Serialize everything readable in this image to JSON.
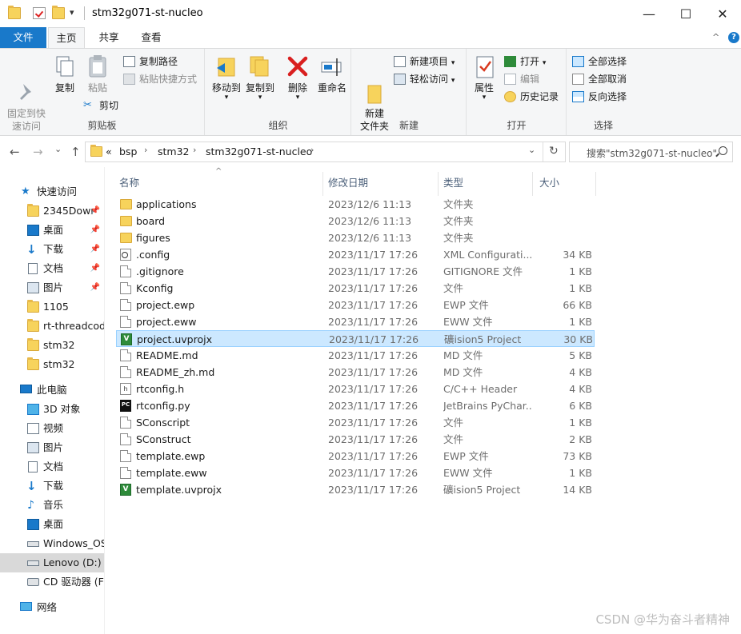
{
  "window": {
    "title": "stm32g071-st-nucleo",
    "minimize": "—",
    "maximize": "☐",
    "close": "✕",
    "quick_menu_arrow": "▾"
  },
  "ribbon_tabs": {
    "file": "文件",
    "home": "主页",
    "share": "共享",
    "view": "查看",
    "collapse_arrow": "^",
    "help": "?"
  },
  "ribbon": {
    "clipboard": {
      "label": "剪贴板",
      "pin_quick_access": "固定到快\n速访问",
      "copy": "复制",
      "paste": "粘贴",
      "copy_path": "复制路径",
      "paste_shortcut": "粘贴快捷方式",
      "cut": "剪切"
    },
    "organize": {
      "label": "组织",
      "move_to": "移动到",
      "copy_to": "复制到",
      "delete": "删除",
      "rename": "重命名"
    },
    "new": {
      "label": "新建",
      "new_folder": "新建\n文件夹",
      "new_item": "新建项目",
      "easy_access": "轻松访问"
    },
    "open": {
      "label": "打开",
      "properties": "属性",
      "open": "打开",
      "edit": "编辑",
      "history": "历史记录"
    },
    "select": {
      "label": "选择",
      "select_all": "全部选择",
      "select_none": "全部取消",
      "invert": "反向选择"
    }
  },
  "address": {
    "back": "←",
    "forward": "→",
    "recent": "⌄",
    "up": "↑",
    "overflow": "«",
    "crumbs": [
      "bsp",
      "stm32",
      "stm32g071-st-nucleo"
    ],
    "sep": "›",
    "dropdown": "⌄",
    "refresh": "↻",
    "search_placeholder": "搜索\"stm32g071-st-nucleo\""
  },
  "sidebar": {
    "items": [
      {
        "label": "快速访问",
        "icon": "star-icon"
      },
      {
        "label": "2345Dowr",
        "icon": "folder-icon",
        "pinned": true
      },
      {
        "label": "桌面",
        "icon": "desktop-icon",
        "pinned": true
      },
      {
        "label": "下载",
        "icon": "download-icon",
        "pinned": true
      },
      {
        "label": "文档",
        "icon": "document-icon",
        "pinned": true
      },
      {
        "label": "图片",
        "icon": "picture-icon",
        "pinned": true
      },
      {
        "label": "1105",
        "icon": "folder-icon"
      },
      {
        "label": "rt-threadcod",
        "icon": "folder-icon"
      },
      {
        "label": "stm32",
        "icon": "folder-icon"
      },
      {
        "label": "stm32",
        "icon": "folder-icon"
      },
      {
        "label": "此电脑",
        "icon": "computer-icon"
      },
      {
        "label": "3D 对象",
        "icon": "3d-objects-icon"
      },
      {
        "label": "视频",
        "icon": "video-icon"
      },
      {
        "label": "图片",
        "icon": "picture-icon"
      },
      {
        "label": "文档",
        "icon": "document-icon"
      },
      {
        "label": "下载",
        "icon": "download-icon"
      },
      {
        "label": "音乐",
        "icon": "music-icon"
      },
      {
        "label": "桌面",
        "icon": "desktop-icon"
      },
      {
        "label": "Windows_OS",
        "icon": "drive-icon"
      },
      {
        "label": "Lenovo (D:)",
        "icon": "drive-icon"
      },
      {
        "label": "CD 驱动器 (F:",
        "icon": "cd-drive-icon"
      },
      {
        "label": "网络",
        "icon": "network-icon"
      }
    ],
    "pin_glyph": "📌"
  },
  "columns": {
    "name": "名称",
    "date": "修改日期",
    "type": "类型",
    "size": "大小",
    "sort_arrow": "^"
  },
  "files": [
    {
      "name": "applications",
      "date": "2023/12/6 11:13",
      "type": "文件夹",
      "size": "",
      "icon": "folder"
    },
    {
      "name": "board",
      "date": "2023/12/6 11:13",
      "type": "文件夹",
      "size": "",
      "icon": "folder"
    },
    {
      "name": "figures",
      "date": "2023/12/6 11:13",
      "type": "文件夹",
      "size": "",
      "icon": "folder"
    },
    {
      "name": ".config",
      "date": "2023/11/17 17:26",
      "type": "XML Configurati...",
      "size": "34 KB",
      "icon": "cfg"
    },
    {
      "name": ".gitignore",
      "date": "2023/11/17 17:26",
      "type": "GITIGNORE 文件",
      "size": "1 KB",
      "icon": "doc"
    },
    {
      "name": "Kconfig",
      "date": "2023/11/17 17:26",
      "type": "文件",
      "size": "1 KB",
      "icon": "doc"
    },
    {
      "name": "project.ewp",
      "date": "2023/11/17 17:26",
      "type": "EWP 文件",
      "size": "66 KB",
      "icon": "doc"
    },
    {
      "name": "project.eww",
      "date": "2023/11/17 17:26",
      "type": "EWW 文件",
      "size": "1 KB",
      "icon": "doc"
    },
    {
      "name": "project.uvprojx",
      "date": "2023/11/17 17:26",
      "type": "礦ision5 Project",
      "size": "30 KB",
      "icon": "uv",
      "selected": true
    },
    {
      "name": "README.md",
      "date": "2023/11/17 17:26",
      "type": "MD 文件",
      "size": "5 KB",
      "icon": "doc"
    },
    {
      "name": "README_zh.md",
      "date": "2023/11/17 17:26",
      "type": "MD 文件",
      "size": "4 KB",
      "icon": "doc"
    },
    {
      "name": "rtconfig.h",
      "date": "2023/11/17 17:26",
      "type": "C/C++ Header",
      "size": "4 KB",
      "icon": "h"
    },
    {
      "name": "rtconfig.py",
      "date": "2023/11/17 17:26",
      "type": "JetBrains PyChar...",
      "size": "6 KB",
      "icon": "pc"
    },
    {
      "name": "SConscript",
      "date": "2023/11/17 17:26",
      "type": "文件",
      "size": "1 KB",
      "icon": "doc"
    },
    {
      "name": "SConstruct",
      "date": "2023/11/17 17:26",
      "type": "文件",
      "size": "2 KB",
      "icon": "doc"
    },
    {
      "name": "template.ewp",
      "date": "2023/11/17 17:26",
      "type": "EWP 文件",
      "size": "73 KB",
      "icon": "doc"
    },
    {
      "name": "template.eww",
      "date": "2023/11/17 17:26",
      "type": "EWW 文件",
      "size": "1 KB",
      "icon": "doc"
    },
    {
      "name": "template.uvprojx",
      "date": "2023/11/17 17:26",
      "type": "礦ision5 Project",
      "size": "14 KB",
      "icon": "uv"
    }
  ],
  "watermark": "CSDN @华为奋斗者精神",
  "colors": {
    "accent": "#1979ca",
    "selection": "#cce8ff",
    "folder": "#f7d35c"
  }
}
